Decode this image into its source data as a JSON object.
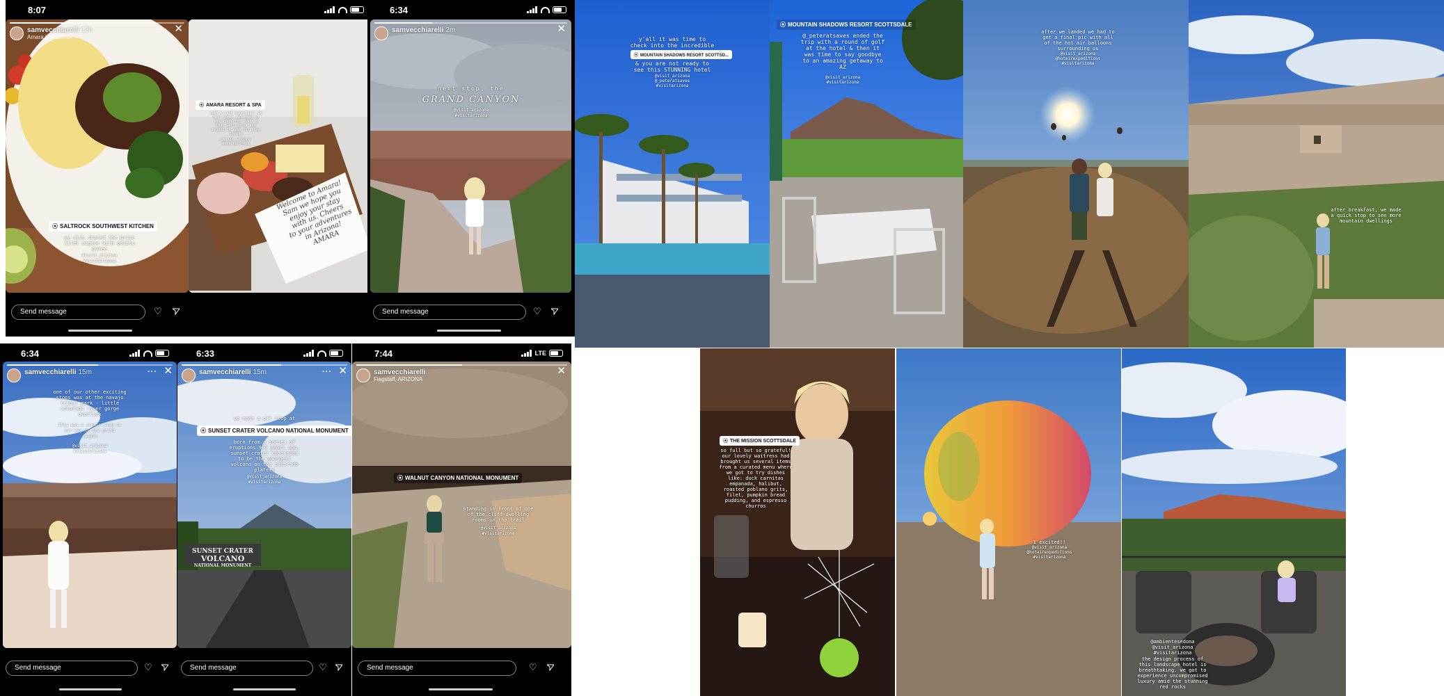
{
  "colors": {
    "ig_white": "#ffffff",
    "ig_black": "#000000"
  },
  "ui": {
    "send_message": "Send message",
    "more_icon": "dots-icon",
    "close_icon": "x-icon"
  },
  "phones": [
    {
      "id": "a",
      "time": "8:07",
      "network": "wifi"
    },
    {
      "id": "b",
      "time": "6:34",
      "network": "wifi"
    },
    {
      "id": "c",
      "time": "6:33",
      "network": "wifi"
    },
    {
      "id": "d",
      "time": "7:44",
      "network": "LTE"
    }
  ],
  "stories": {
    "s1": {
      "username": "samvecchiarelli",
      "age": "13h",
      "sublocation": "Amara | ARIZONA",
      "location": "SALTROCK SOUTHWEST KITCHEN",
      "caption": "we also shared the prime\nfilet mignon with potato\npuree",
      "tags": "#visit_arizona\n#visitarizona"
    },
    "s2": {
      "time": "8:07",
      "location": "AMARA RESORT & SPA",
      "caption": "such a cute surprise!! we\nfelt super welcomed by\nthe wonderful staff &\nthey went above and\nbeyond to make our stay\nlovely",
      "tags": "@visit_arizona\n#visitarizona",
      "note": "Welcome to Amara!\nSam we hope you\nenjoy your stay\nwith us. Cheers\nto your adventures\nin Arizona!\nAMARA"
    },
    "s3": {
      "time": "6:34",
      "username": "samvecchiarelli",
      "age": "2m",
      "caption_a": "next stop, the",
      "caption_b": "GRAND CANYON",
      "tags": "@visit_arizona\n#visitarizona"
    },
    "s4": {
      "username": "samvecchiarelli",
      "age": "15m",
      "caption": "one of our other exciting\nstops was at the navajo\ntribal park - little\ncolorado river gorge\noverlook",
      "caption2": "this was a scenic stop on\nour way to the grand\ncanyon",
      "tags": "@visit_arizona\n#visitarizona"
    },
    "s5": {
      "username": "samvecchiarelli",
      "age": "15m",
      "caption_top": "we made a pit stop at",
      "location": "SUNSET CRATER VOLCANO NATIONAL MONUMENT",
      "caption": "born from a series of\neruptions 900 years ago,\nsunset crater continues\nto be the youngest\nvolcano on the colorado\nplateau",
      "tags": "@visit_arizona\n#visitarizona",
      "sign": [
        "SUNSET CRATER",
        "VOLCANO",
        "NATIONAL MONUMENT"
      ]
    },
    "s6": {
      "username": "samvecchiarelli",
      "sublocation": "Flagstaff, ARIZONA",
      "location": "WALNUT CANYON NATIONAL MONUMENT",
      "caption": "standing in front of one\nof the cliff-dwelling\nrooms on the trail",
      "tags": "@visit_arizona\n#visitarizona"
    }
  },
  "photos": {
    "p1": {
      "caption_a": "y'all it was time to\ncheck into the incredible",
      "location": "MOUNTAIN SHADOWS RESORT SCOTTSD...",
      "caption_b": "& you are not ready to\nsee this STUNNING hotel",
      "tags": "@visit_arizona\n@_peteratsaves\n#visitarizona"
    },
    "p2": {
      "location": "MOUNTAIN SHADOWS RESORT SCOTTSDALE",
      "caption": "@_peteratsaves ended the\ntrip with a round of golf\nat the hotel & then it\nwas time to say goodbye\nto an amazing getaway to\nAZ",
      "tags": "@visit_arizona\n#visitarizona"
    },
    "p3": {
      "caption": "after we landed we had to\nget a final pic with all\nof the hot air balloons\nsurrounding us",
      "tags": "@visit_arizona\n@hotairexpeditions\n#visitarizona"
    },
    "p4": {
      "caption": "after breakfast, we made\na quick stop to see more\nmountain dwellings"
    },
    "p5": {
      "location": "THE MISSION SCOTTSDALE",
      "caption": "so full but so grateful!\nour lovely waitress had\nbrought us several items\nfrom a curated menu where\nwe got to try dishes\nlike: duck carnitas\nempanada, halibut,\nroasted poblano grits,\nfilet, pumpkin bread\npudding, and espresso\nchurros"
    },
    "p6": {
      "caption": "I excited!!",
      "tags": "@visit_arizona\n@hotairexpeditions\n#visitarizona"
    },
    "p7": {
      "tags": "@ambientesedona\n@visit_arizona\n#visitarizona",
      "caption": "the design process of\nthis landscape hotel is\nbreathtaking. we got to\nexperience uncompromised\nluxury amid the stunning\nred rocks"
    }
  }
}
